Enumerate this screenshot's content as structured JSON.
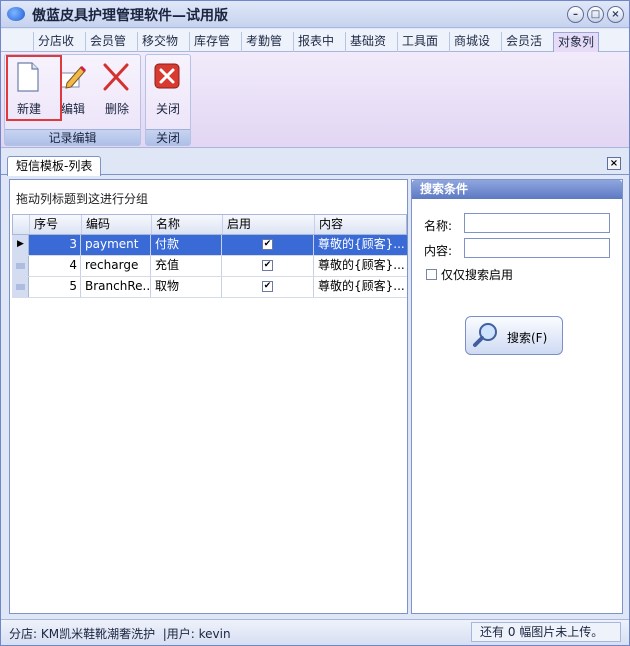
{
  "window": {
    "title": "傲蓝皮具护理管理软件—试用版"
  },
  "menu_tabs": [
    "分店收",
    "会员管",
    "移交物",
    "库存管",
    "考勤管",
    "报表中",
    "基础资",
    "工具面",
    "商城设",
    "会员活",
    "对象列"
  ],
  "active_tab": "对象列",
  "ribbon": {
    "groups": [
      {
        "label": "记录编辑",
        "buttons": [
          "新建",
          "编辑",
          "删除"
        ]
      },
      {
        "label": "关闭",
        "buttons": [
          "关闭"
        ]
      }
    ]
  },
  "doc_tab": {
    "label": "短信模板-列表"
  },
  "grid": {
    "group_hint": "拖动列标题到这进行分组",
    "columns": [
      "序号",
      "编码",
      "名称",
      "启用",
      "内容"
    ],
    "rows": [
      {
        "no": "3",
        "code": "payment",
        "name": "付款",
        "enabled": true,
        "content": "尊敬的{顾客}..."
      },
      {
        "no": "4",
        "code": "recharge",
        "name": "充值",
        "enabled": true,
        "content": "尊敬的{顾客}..."
      },
      {
        "no": "5",
        "code": "BranchRe...",
        "name": "取物",
        "enabled": true,
        "content": "尊敬的{顾客}..."
      }
    ]
  },
  "search_panel": {
    "title": "搜索条件",
    "name_label": "名称:",
    "content_label": "内容:",
    "name_value": "",
    "content_value": "",
    "enabled_only_label": "仅仅搜索启用",
    "search_button": "搜索(F)"
  },
  "status": {
    "store": "分店: KM凯米鞋靴潮奢洗护",
    "user": "|用户: kevin",
    "upload": "还有 0 幅图片未上传。"
  },
  "colors": {
    "selection": "#3a6ad6",
    "highlight_border": "#e0393b"
  }
}
